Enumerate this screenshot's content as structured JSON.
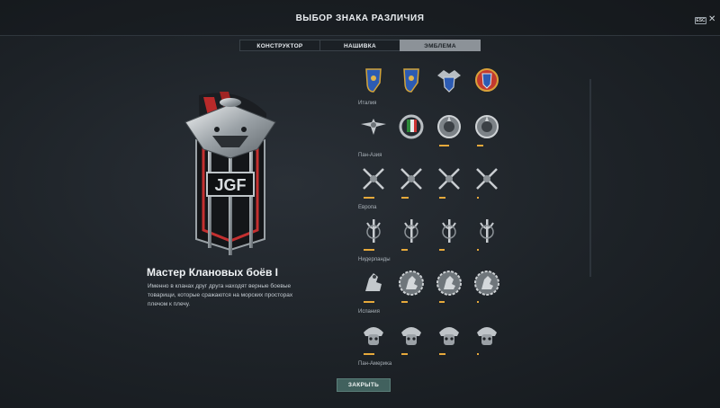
{
  "header": {
    "title": "ВЫБОР ЗНАКА РАЗЛИЧИЯ",
    "esc_label": "ESC",
    "close_glyph": "✕"
  },
  "tabs": [
    {
      "label": "КОНСТРУКТОР",
      "active": false
    },
    {
      "label": "НАШИВКА",
      "active": false
    },
    {
      "label": "ЭМБЛЕМА",
      "active": true
    }
  ],
  "selected": {
    "badge_text": "JGF",
    "name": "Мастер Клановых боёв I",
    "description": "Именно в кланах друг друга находят верные боевые товарищи, которые сражаются на морских просторах плечом к плечу."
  },
  "groups": [
    {
      "label": "",
      "icons": [
        "shield-blue-icon",
        "shield-blue-icon",
        "shield-eagle-icon",
        "shield-ornate-icon"
      ],
      "progress": [
        0,
        0,
        0,
        0
      ]
    },
    {
      "label": "Италия",
      "icons": [
        "wings-anchor-icon",
        "tricolor-shield-icon",
        "laurel-medal-icon",
        "laurel-medal-icon"
      ],
      "progress": [
        0,
        0,
        0.5,
        0.3
      ]
    },
    {
      "label": "Пан-Азия",
      "icons": [
        "crossed-swords-icon",
        "crossed-swords-icon",
        "crossed-swords-icon",
        "crossed-swords-icon"
      ],
      "progress": [
        0.55,
        0.35,
        0.3,
        0.1
      ]
    },
    {
      "label": "Европа",
      "icons": [
        "trident-icon",
        "trident-icon",
        "trident-icon",
        "trident-icon"
      ],
      "progress": [
        0.55,
        0.3,
        0.25,
        0.1
      ]
    },
    {
      "label": "Нидерланды",
      "icons": [
        "lion-icon",
        "lion-medal-icon",
        "lion-medal-icon",
        "lion-medal-icon"
      ],
      "progress": [
        0.55,
        0.3,
        0.25,
        0.1
      ]
    },
    {
      "label": "Испания",
      "icons": [
        "skull-helmet-icon",
        "skull-helmet-icon",
        "skull-helmet-icon",
        "skull-helmet-icon"
      ],
      "progress": [
        0.55,
        0.3,
        0.3,
        0.1
      ]
    },
    {
      "label": "Пан-Америка",
      "icons": [],
      "progress": []
    }
  ],
  "footer": {
    "close_label": "ЗАКРЫТЬ"
  },
  "colors": {
    "accent_progress": "#e6a93b",
    "button": "#41615e",
    "tab_active": "#8c9298"
  }
}
